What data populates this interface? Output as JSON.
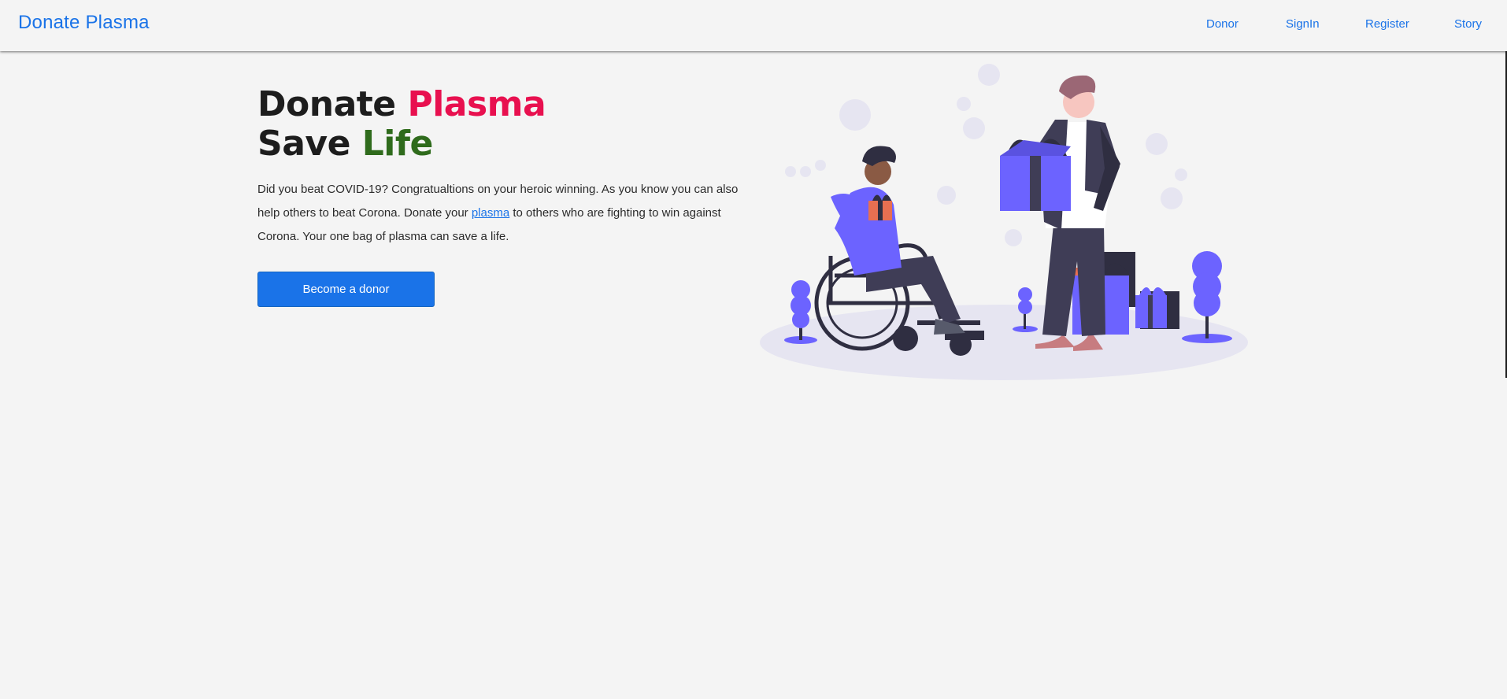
{
  "nav": {
    "brand": "Donate Plasma",
    "links": [
      "Donor",
      "SignIn",
      "Register",
      "Story"
    ]
  },
  "hero": {
    "title_line1_a": "Donate ",
    "title_line1_b": "Plasma",
    "title_line2_a": "Save ",
    "title_line2_b": "Life",
    "paragraph_before": "Did you beat COVID-19? Congratualtions on your heroic winning. As you know you can also help others to beat Corona. Donate your ",
    "paragraph_link": "plasma",
    "paragraph_after": " to others who are fighting to win against Corona. Your one bag of plasma can save a life.",
    "button": "Become a donor"
  },
  "colors": {
    "brand_blue": "#1a73e8",
    "plasma_pink": "#e8104f",
    "life_green": "#2f6b1c",
    "illustration_purple": "#6c63ff",
    "background": "#f4f4f4"
  },
  "icons": {
    "hero_illustration": "wheelchair-gift-illustration"
  }
}
